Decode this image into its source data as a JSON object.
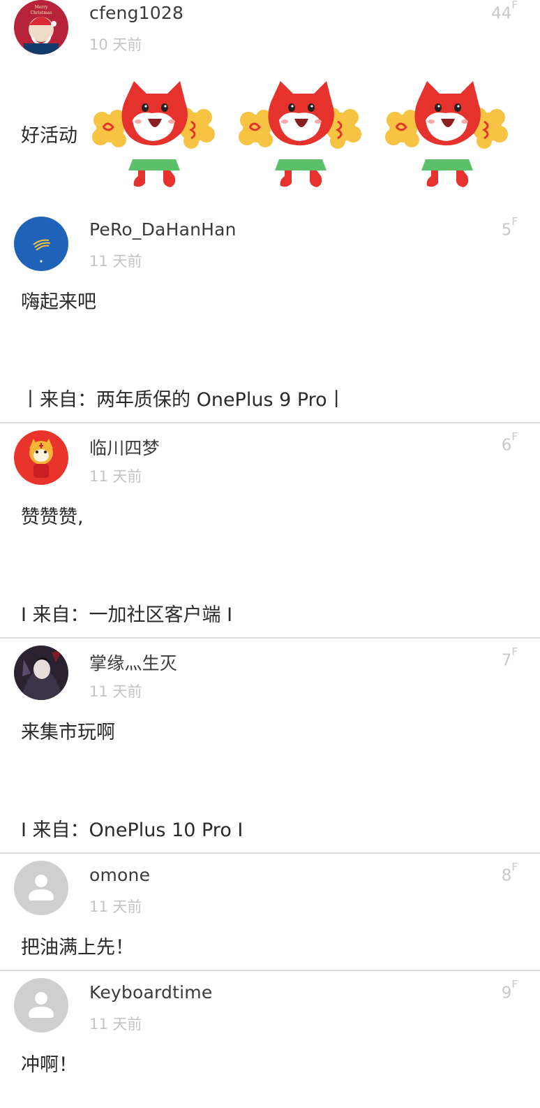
{
  "posts": [
    {
      "username": "cfeng1028",
      "time": "10 天前",
      "floor_num": "44",
      "floor_suffix": "F",
      "content": "好活动",
      "stickers": [
        "cheering-fox-sticker",
        "cheering-fox-sticker",
        "cheering-fox-sticker"
      ],
      "avatar_icon": "christmas-avatar"
    },
    {
      "username": "PeRo_DaHanHan",
      "time": "11 天前",
      "floor_num": "5",
      "floor_suffix": "F",
      "content": "嗨起来吧",
      "source": "丨来自：两年质保的 OnePlus 9 Pro丨",
      "avatar_icon": "blue-logo-avatar"
    },
    {
      "username": "临川四梦",
      "time": "11 天前",
      "floor_num": "6",
      "floor_suffix": "F",
      "content": "赞赞赞,",
      "source": "I 来自：一加社区客户端 I",
      "avatar_icon": "tiger-avatar"
    },
    {
      "username": "掌缘灬生灭",
      "time": "11 天前",
      "floor_num": "7",
      "floor_suffix": "F",
      "content": "来集市玩啊",
      "source": "I 来自：OnePlus 10 Pro I",
      "avatar_icon": "dark-character-avatar"
    },
    {
      "username": "omone",
      "time": "11 天前",
      "floor_num": "8",
      "floor_suffix": "F",
      "content": "把油满上先！",
      "avatar_icon": "default-user-avatar"
    },
    {
      "username": "Keyboardtime",
      "time": "11 天前",
      "floor_num": "9",
      "floor_suffix": "F",
      "content": "冲啊！",
      "avatar_icon": "default-user-avatar"
    }
  ],
  "colors": {
    "divider": "#dcdcdc",
    "meta_text": "#c4c4c4",
    "body_text": "#2a2a2a",
    "default_avatar_bg": "#cfcfcf",
    "tiger_avatar_bg": "#e8342b",
    "blue_avatar_bg": "#1f63b8",
    "fox_red": "#e5322c",
    "pompom_yellow": "#f6c343",
    "skirt_green": "#5cbf6a"
  }
}
